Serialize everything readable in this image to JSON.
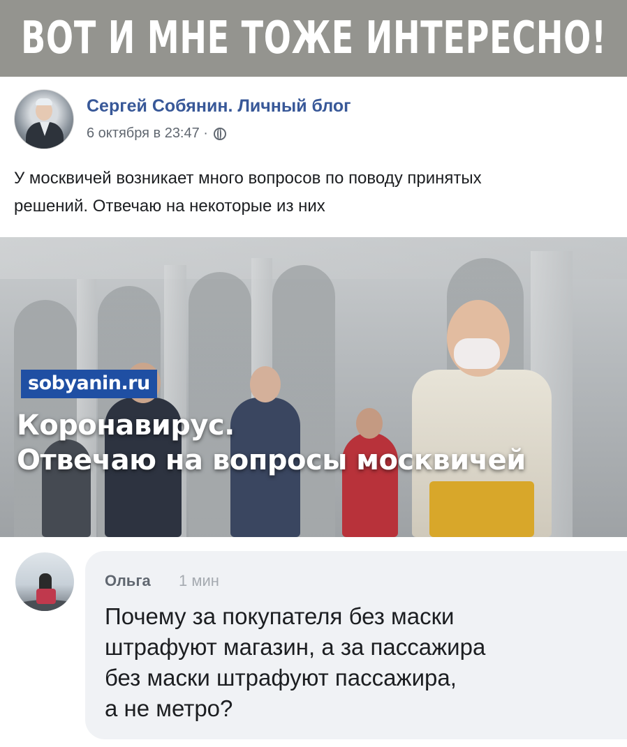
{
  "banner": {
    "title": "ВОТ И МНЕ ТОЖЕ ИНТЕРЕСНО!"
  },
  "post": {
    "author": "Сергей Собянин. Личный блог",
    "date": "6 октября в 23:47 ·",
    "privacy_icon": "globe-icon",
    "text_line1": "У москвичей возникает много вопросов по поводу принятых",
    "text_line2": "решений. Отвечаю на некоторые из них"
  },
  "image": {
    "site_tag": "sobyanin.ru",
    "headline_line1": "Коронавирус.",
    "headline_line2": "Отвечаю на вопросы москвичей"
  },
  "comment": {
    "author": "Ольга",
    "time": "1 мин",
    "line1": "Почему за покупателя без маски",
    "line2": "штрафуют магазин, а за пассажира",
    "line3": "без маски штрафуют пассажира,",
    "line4": "а не метро?"
  },
  "colors": {
    "banner_bg": "#94948f",
    "author_link": "#385898",
    "site_tag_bg": "#1f4fa3",
    "comment_bubble": "#f0f2f5"
  }
}
